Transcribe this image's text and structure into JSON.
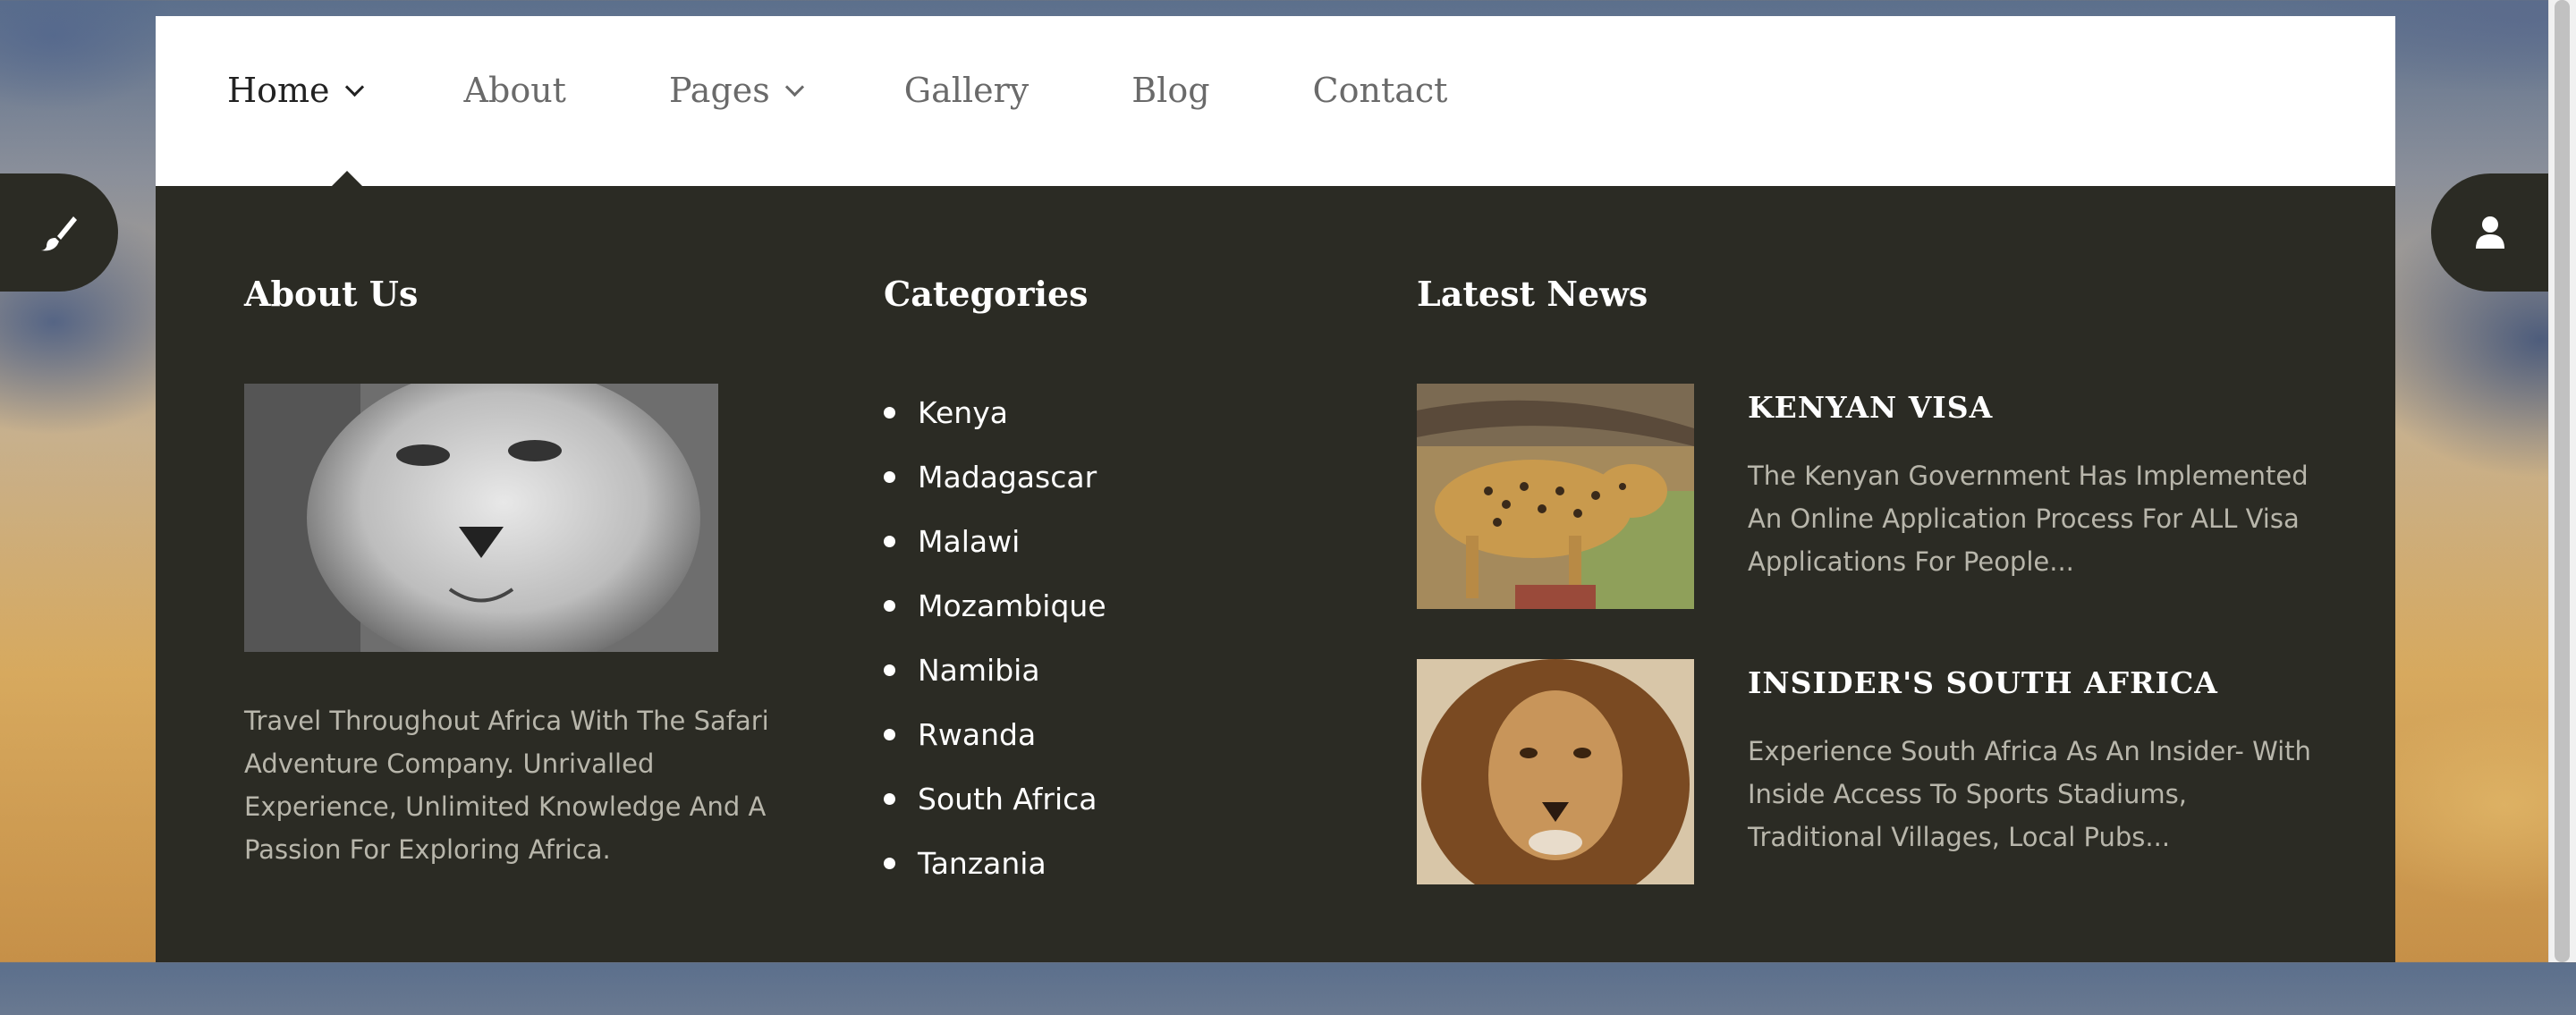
{
  "nav": {
    "items": [
      {
        "label": "Home",
        "has_dropdown": true,
        "active": true
      },
      {
        "label": "About",
        "has_dropdown": false
      },
      {
        "label": "Pages",
        "has_dropdown": true
      },
      {
        "label": "Gallery",
        "has_dropdown": false
      },
      {
        "label": "Blog",
        "has_dropdown": false
      },
      {
        "label": "Contact",
        "has_dropdown": false
      }
    ]
  },
  "mega_menu": {
    "about": {
      "heading": "About Us",
      "image": "lion-bw-photo",
      "text": "Travel Throughout Africa With The Safari Adventure Company. Unrivalled Experience, Unlimited Knowledge And A Passion For Exploring Africa."
    },
    "categories": {
      "heading": "Categories",
      "items": [
        "Kenya",
        "Madagascar",
        "Malawi",
        "Mozambique",
        "Namibia",
        "Rwanda",
        "South Africa",
        "Tanzania"
      ]
    },
    "news": {
      "heading": "Latest News",
      "items": [
        {
          "title": "KENYAN VISA",
          "image": "leopard-photo",
          "text": "The Kenyan Government Has Implemented An Online Application Process For ALL Visa Applications For People..."
        },
        {
          "title": "INSIDER'S SOUTH AFRICA",
          "image": "lion-photo",
          "text": "Experience South Africa As An Insider- With Inside Access To Sports Stadiums, Traditional Villages, Local Pubs..."
        }
      ]
    }
  },
  "side_buttons": {
    "left_icon": "paintbrush-icon",
    "right_icon": "user-icon"
  },
  "colors": {
    "menu_bg": "#2b2b24",
    "muted_text": "#b8b6ab",
    "nav_active": "#222222",
    "nav_text": "#6a6a6a"
  }
}
